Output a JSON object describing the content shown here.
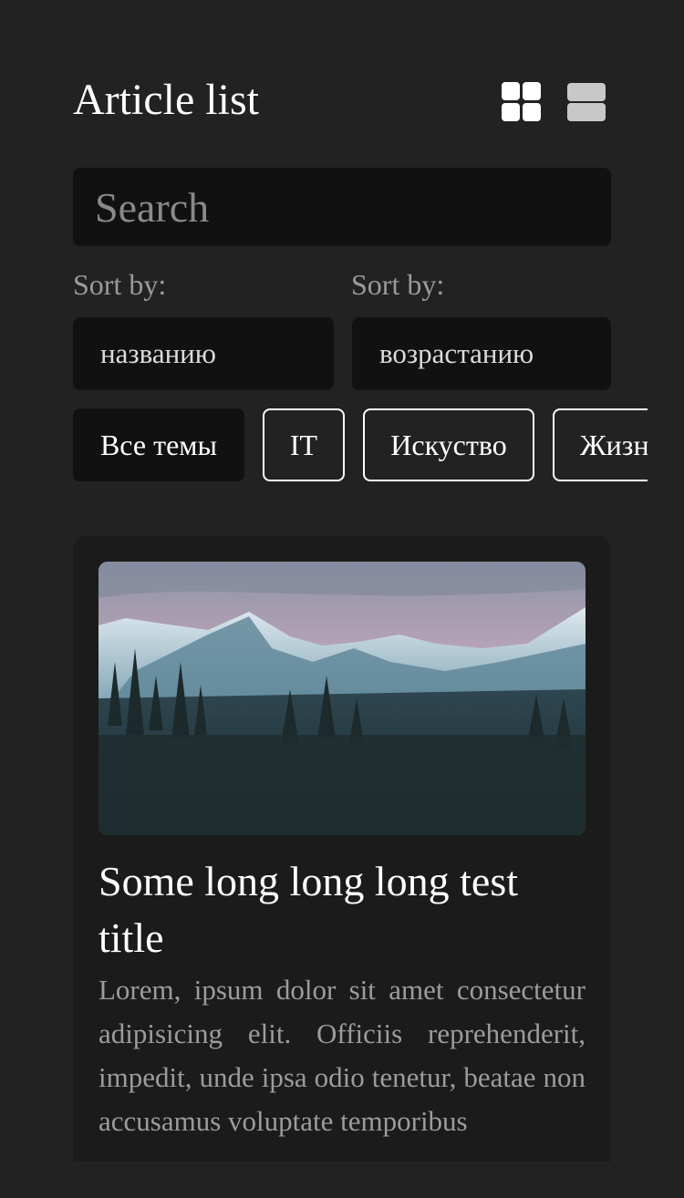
{
  "header": {
    "title": "Article list"
  },
  "search": {
    "placeholder": "Search",
    "value": ""
  },
  "sort": {
    "field_label": "Sort by:",
    "field_value": "названию",
    "order_label": "Sort by:",
    "order_value": "возрастанию"
  },
  "topics": [
    {
      "label": "Все темы",
      "active": true
    },
    {
      "label": "IT",
      "active": false
    },
    {
      "label": "Искуство",
      "active": false
    },
    {
      "label": "Жизнь",
      "active": false
    }
  ],
  "article": {
    "image": "mountain-forest-landscape",
    "title": "Some long long long test title",
    "text": "Lorem, ipsum dolor sit amet consectetur adipisicing elit. Officiis reprehenderit, impedit, unde ipsa odio tenetur, beatae non accusamus voluptate temporibus"
  },
  "icons": {
    "grid_view": "grid-view-icon",
    "list_view": "list-view-icon"
  },
  "colors": {
    "background": "#222222",
    "surface": "#111111",
    "card": "#1b1b1b",
    "text": "#ffffff",
    "muted": "#9a9a9a"
  }
}
